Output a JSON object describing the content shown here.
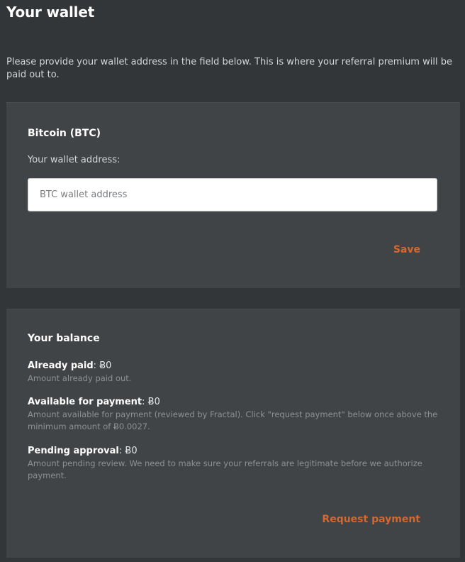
{
  "header": {
    "title": "Your wallet",
    "intro": "Please provide your wallet address in the field below. This is where your referral premium will be paid out to."
  },
  "wallet_card": {
    "heading": "Bitcoin (BTC)",
    "field_label": "Your wallet address:",
    "input_placeholder": "BTC wallet address",
    "input_value": "",
    "save_label": "Save"
  },
  "balance_card": {
    "heading": "Your balance",
    "items": [
      {
        "label": "Already paid",
        "value": "Ƀ0",
        "description": "Amount already paid out."
      },
      {
        "label": "Available for payment",
        "value": "Ƀ0",
        "description": "Amount available for payment (reviewed by Fractal). Click \"request payment\" below once above the minimum amount of Ƀ0.0027."
      },
      {
        "label": "Pending approval",
        "value": "Ƀ0",
        "description": "Amount pending review. We need to make sure your referrals are legitimate before we authorize payment."
      }
    ],
    "request_label": "Request payment"
  },
  "colors": {
    "background": "#333638",
    "card": "#414446",
    "accent": "#d5672f"
  }
}
